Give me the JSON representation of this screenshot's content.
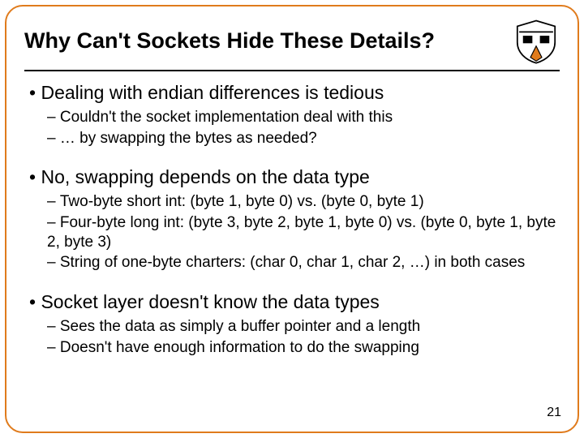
{
  "title": "Why Can't Sockets Hide These Details?",
  "sections": [
    {
      "heading": "Dealing with endian differences is tedious",
      "subs": [
        "Couldn't the socket implementation deal with this",
        "… by swapping the bytes as needed?"
      ]
    },
    {
      "heading": "No, swapping depends on the data type",
      "subs": [
        "Two-byte short int: (byte 1, byte 0) vs. (byte 0, byte 1)",
        "Four-byte long int: (byte 3, byte 2, byte 1, byte 0) vs. (byte 0, byte 1, byte 2, byte 3)",
        "String of one-byte charters: (char 0, char 1, char 2, …) in both cases"
      ]
    },
    {
      "heading": "Socket layer doesn't know the data types",
      "subs": [
        "Sees the data as simply a buffer pointer and a length",
        "Doesn't have enough information to do the swapping"
      ]
    }
  ],
  "page_number": "21",
  "crest_alt": "university-shield-icon"
}
